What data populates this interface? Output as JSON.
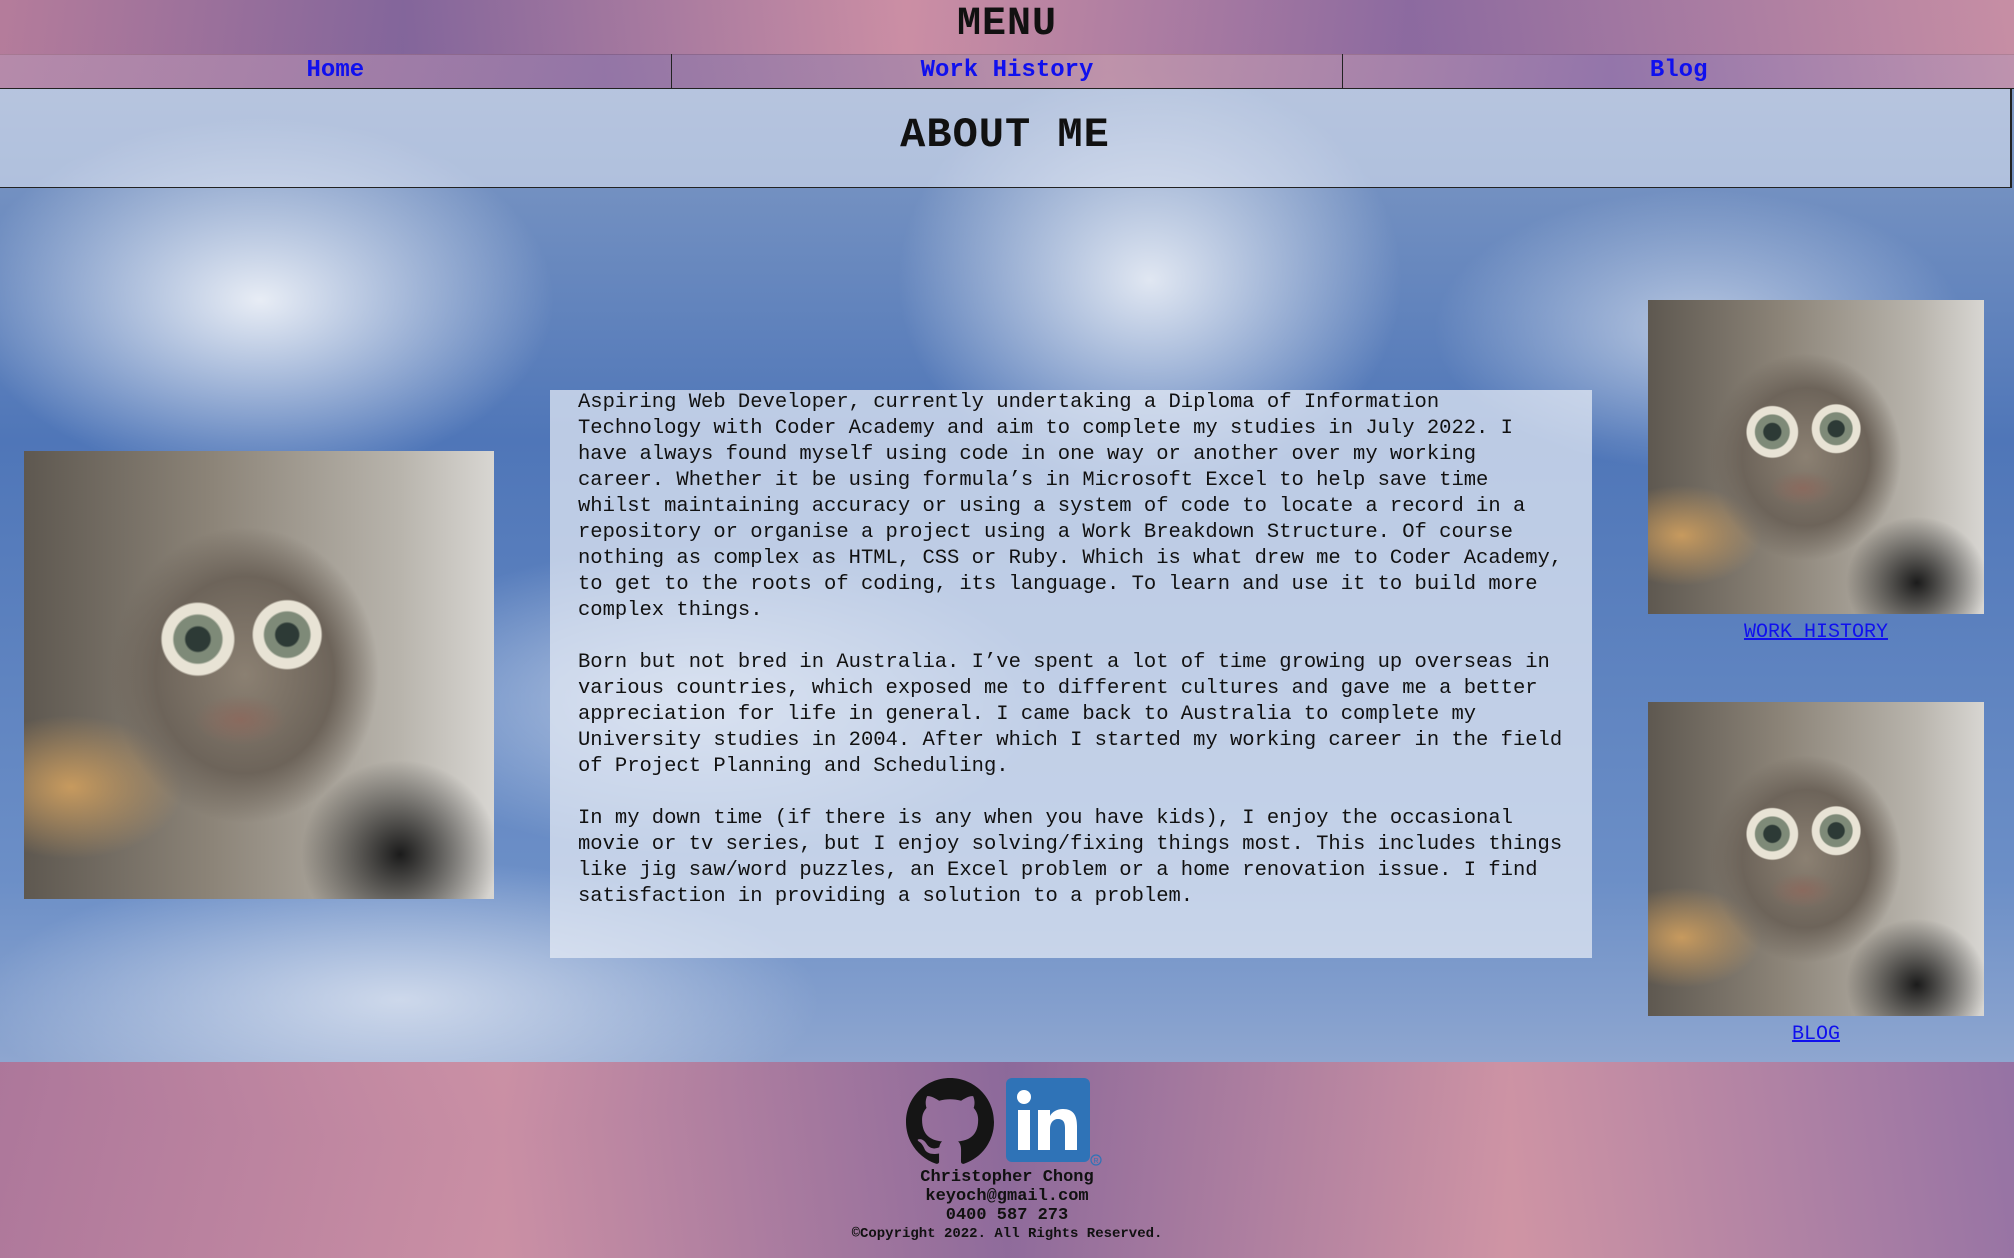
{
  "menu": {
    "title": "MENU",
    "items": [
      {
        "label": "Home"
      },
      {
        "label": "Work History"
      },
      {
        "label": "Blog"
      }
    ]
  },
  "page": {
    "heading": "ABOUT ME"
  },
  "about": {
    "paragraphs": [
      "Aspiring Web Developer, currently undertaking a Diploma of Information Technology with Coder Academy and aim to complete my studies in July 2022. I have always found myself using code in one way or another over my working career. Whether it be using formula’s in Microsoft Excel to help save time whilst maintaining accuracy or using a system of code to locate a record in a repository or organise a project using a Work Breakdown Structure. Of course nothing as complex as HTML, CSS or Ruby. Which is what drew me to Coder Academy, to get to the roots of coding, its language. To learn and use it to build more complex things.",
      "Born but not bred in Australia. I’ve spent a lot of time growing up overseas in various countries, which exposed me to different cultures and gave me a better appreciation for life in general. I came back to Australia to complete my University studies in 2004. After which I started my working career in the field of Project Planning and Scheduling.",
      "In my down time (if there is any when you have kids), I enjoy the occasional movie or tv series, but I enjoy solving/fixing things most. This includes things like jig saw/word puzzles, an Excel problem or a home renovation issue. I find satisfaction in providing a solution to a problem."
    ]
  },
  "side_links": {
    "work_history": "WORK HISTORY",
    "blog": "BLOG"
  },
  "footer": {
    "icons": [
      "github-icon",
      "linkedin-icon"
    ],
    "name": "Christopher Chong",
    "email": "keyoch@gmail.com",
    "phone": "0400 587 273",
    "copyright": "©Copyright 2022. All Rights Reserved."
  },
  "colors": {
    "link": "#1010ee",
    "linkedin": "#2f73b7"
  }
}
